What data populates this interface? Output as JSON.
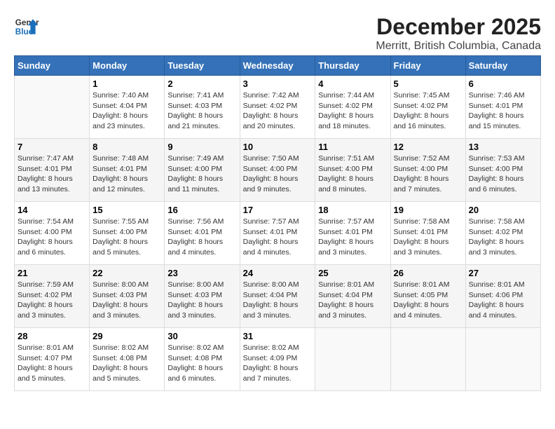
{
  "logo": {
    "line1": "General",
    "line2": "Blue"
  },
  "title": "December 2025",
  "subtitle": "Merritt, British Columbia, Canada",
  "days_header": [
    "Sunday",
    "Monday",
    "Tuesday",
    "Wednesday",
    "Thursday",
    "Friday",
    "Saturday"
  ],
  "weeks": [
    [
      {
        "num": "",
        "sunrise": "",
        "sunset": "",
        "daylight": ""
      },
      {
        "num": "1",
        "sunrise": "Sunrise: 7:40 AM",
        "sunset": "Sunset: 4:04 PM",
        "daylight": "Daylight: 8 hours and 23 minutes."
      },
      {
        "num": "2",
        "sunrise": "Sunrise: 7:41 AM",
        "sunset": "Sunset: 4:03 PM",
        "daylight": "Daylight: 8 hours and 21 minutes."
      },
      {
        "num": "3",
        "sunrise": "Sunrise: 7:42 AM",
        "sunset": "Sunset: 4:02 PM",
        "daylight": "Daylight: 8 hours and 20 minutes."
      },
      {
        "num": "4",
        "sunrise": "Sunrise: 7:44 AM",
        "sunset": "Sunset: 4:02 PM",
        "daylight": "Daylight: 8 hours and 18 minutes."
      },
      {
        "num": "5",
        "sunrise": "Sunrise: 7:45 AM",
        "sunset": "Sunset: 4:02 PM",
        "daylight": "Daylight: 8 hours and 16 minutes."
      },
      {
        "num": "6",
        "sunrise": "Sunrise: 7:46 AM",
        "sunset": "Sunset: 4:01 PM",
        "daylight": "Daylight: 8 hours and 15 minutes."
      }
    ],
    [
      {
        "num": "7",
        "sunrise": "Sunrise: 7:47 AM",
        "sunset": "Sunset: 4:01 PM",
        "daylight": "Daylight: 8 hours and 13 minutes."
      },
      {
        "num": "8",
        "sunrise": "Sunrise: 7:48 AM",
        "sunset": "Sunset: 4:01 PM",
        "daylight": "Daylight: 8 hours and 12 minutes."
      },
      {
        "num": "9",
        "sunrise": "Sunrise: 7:49 AM",
        "sunset": "Sunset: 4:00 PM",
        "daylight": "Daylight: 8 hours and 11 minutes."
      },
      {
        "num": "10",
        "sunrise": "Sunrise: 7:50 AM",
        "sunset": "Sunset: 4:00 PM",
        "daylight": "Daylight: 8 hours and 9 minutes."
      },
      {
        "num": "11",
        "sunrise": "Sunrise: 7:51 AM",
        "sunset": "Sunset: 4:00 PM",
        "daylight": "Daylight: 8 hours and 8 minutes."
      },
      {
        "num": "12",
        "sunrise": "Sunrise: 7:52 AM",
        "sunset": "Sunset: 4:00 PM",
        "daylight": "Daylight: 8 hours and 7 minutes."
      },
      {
        "num": "13",
        "sunrise": "Sunrise: 7:53 AM",
        "sunset": "Sunset: 4:00 PM",
        "daylight": "Daylight: 8 hours and 6 minutes."
      }
    ],
    [
      {
        "num": "14",
        "sunrise": "Sunrise: 7:54 AM",
        "sunset": "Sunset: 4:00 PM",
        "daylight": "Daylight: 8 hours and 6 minutes."
      },
      {
        "num": "15",
        "sunrise": "Sunrise: 7:55 AM",
        "sunset": "Sunset: 4:00 PM",
        "daylight": "Daylight: 8 hours and 5 minutes."
      },
      {
        "num": "16",
        "sunrise": "Sunrise: 7:56 AM",
        "sunset": "Sunset: 4:01 PM",
        "daylight": "Daylight: 8 hours and 4 minutes."
      },
      {
        "num": "17",
        "sunrise": "Sunrise: 7:57 AM",
        "sunset": "Sunset: 4:01 PM",
        "daylight": "Daylight: 8 hours and 4 minutes."
      },
      {
        "num": "18",
        "sunrise": "Sunrise: 7:57 AM",
        "sunset": "Sunset: 4:01 PM",
        "daylight": "Daylight: 8 hours and 3 minutes."
      },
      {
        "num": "19",
        "sunrise": "Sunrise: 7:58 AM",
        "sunset": "Sunset: 4:01 PM",
        "daylight": "Daylight: 8 hours and 3 minutes."
      },
      {
        "num": "20",
        "sunrise": "Sunrise: 7:58 AM",
        "sunset": "Sunset: 4:02 PM",
        "daylight": "Daylight: 8 hours and 3 minutes."
      }
    ],
    [
      {
        "num": "21",
        "sunrise": "Sunrise: 7:59 AM",
        "sunset": "Sunset: 4:02 PM",
        "daylight": "Daylight: 8 hours and 3 minutes."
      },
      {
        "num": "22",
        "sunrise": "Sunrise: 8:00 AM",
        "sunset": "Sunset: 4:03 PM",
        "daylight": "Daylight: 8 hours and 3 minutes."
      },
      {
        "num": "23",
        "sunrise": "Sunrise: 8:00 AM",
        "sunset": "Sunset: 4:03 PM",
        "daylight": "Daylight: 8 hours and 3 minutes."
      },
      {
        "num": "24",
        "sunrise": "Sunrise: 8:00 AM",
        "sunset": "Sunset: 4:04 PM",
        "daylight": "Daylight: 8 hours and 3 minutes."
      },
      {
        "num": "25",
        "sunrise": "Sunrise: 8:01 AM",
        "sunset": "Sunset: 4:04 PM",
        "daylight": "Daylight: 8 hours and 3 minutes."
      },
      {
        "num": "26",
        "sunrise": "Sunrise: 8:01 AM",
        "sunset": "Sunset: 4:05 PM",
        "daylight": "Daylight: 8 hours and 4 minutes."
      },
      {
        "num": "27",
        "sunrise": "Sunrise: 8:01 AM",
        "sunset": "Sunset: 4:06 PM",
        "daylight": "Daylight: 8 hours and 4 minutes."
      }
    ],
    [
      {
        "num": "28",
        "sunrise": "Sunrise: 8:01 AM",
        "sunset": "Sunset: 4:07 PM",
        "daylight": "Daylight: 8 hours and 5 minutes."
      },
      {
        "num": "29",
        "sunrise": "Sunrise: 8:02 AM",
        "sunset": "Sunset: 4:08 PM",
        "daylight": "Daylight: 8 hours and 5 minutes."
      },
      {
        "num": "30",
        "sunrise": "Sunrise: 8:02 AM",
        "sunset": "Sunset: 4:08 PM",
        "daylight": "Daylight: 8 hours and 6 minutes."
      },
      {
        "num": "31",
        "sunrise": "Sunrise: 8:02 AM",
        "sunset": "Sunset: 4:09 PM",
        "daylight": "Daylight: 8 hours and 7 minutes."
      },
      {
        "num": "",
        "sunrise": "",
        "sunset": "",
        "daylight": ""
      },
      {
        "num": "",
        "sunrise": "",
        "sunset": "",
        "daylight": ""
      },
      {
        "num": "",
        "sunrise": "",
        "sunset": "",
        "daylight": ""
      }
    ]
  ]
}
